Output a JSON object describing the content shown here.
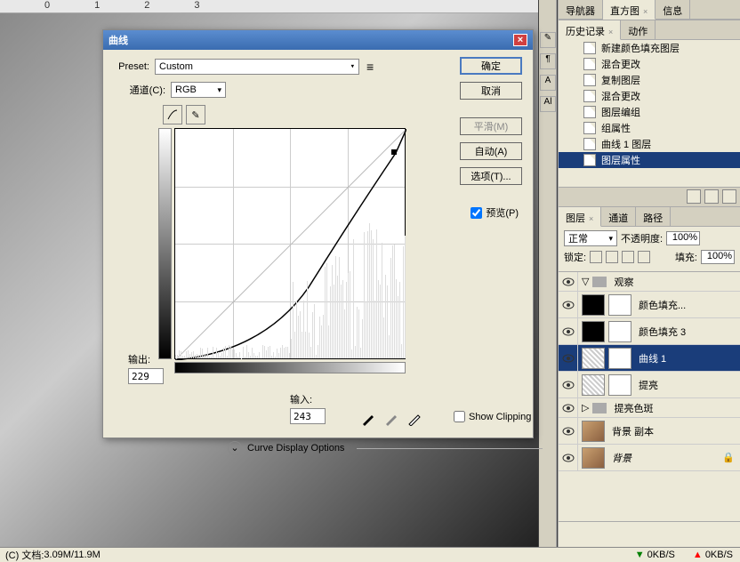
{
  "dialog": {
    "title": "曲线",
    "preset_label": "Preset:",
    "preset_value": "Custom",
    "channel_label": "通道(C):",
    "channel_value": "RGB",
    "output_label": "输出:",
    "output_value": "229",
    "input_label": "输入:",
    "input_value": "243",
    "show_clipping": "Show Clipping",
    "curve_options": "Curve Display Options",
    "buttons": {
      "ok": "确定",
      "cancel": "取消",
      "smooth": "平滑(M)",
      "auto": "自动(A)",
      "options": "选项(T)..."
    },
    "preview": "预览(P)"
  },
  "chart_data": {
    "type": "line",
    "title": "曲线",
    "xlabel": "输入",
    "ylabel": "输出",
    "xlim": [
      0,
      255
    ],
    "ylim": [
      0,
      255
    ],
    "grid": true,
    "series": [
      {
        "name": "diagonal",
        "x": [
          0,
          255
        ],
        "y": [
          0,
          255
        ]
      },
      {
        "name": "curve",
        "x": [
          0,
          50,
          100,
          150,
          200,
          243,
          255
        ],
        "y": [
          0,
          8,
          30,
          80,
          160,
          229,
          255
        ]
      }
    ],
    "points": [
      {
        "x": 0,
        "y": 0
      },
      {
        "x": 243,
        "y": 229
      },
      {
        "x": 255,
        "y": 255
      }
    ],
    "histogram_peaks": "right-weighted"
  },
  "panels": {
    "nav_tabs": [
      "导航器",
      "直方图",
      "信息"
    ],
    "nav_active": 1,
    "history_tabs": [
      "历史记录",
      "动作"
    ],
    "history_active": 0,
    "history_items": [
      "新建颜色填充图层",
      "混合更改",
      "复制图层",
      "混合更改",
      "图层编组",
      "组属性",
      "曲线 1 图层",
      "图层属性"
    ],
    "history_selected": 7,
    "layer_tabs": [
      "图层",
      "通道",
      "路径"
    ],
    "layer_active": 0,
    "blend_mode": "正常",
    "opacity_label": "不透明度:",
    "opacity_value": "100%",
    "lock_label": "锁定:",
    "fill_label": "填充:",
    "fill_value": "100%",
    "layers": [
      {
        "type": "group",
        "name": "观察",
        "expanded": true
      },
      {
        "type": "fill",
        "name": "颜色填充...",
        "thumb": "black"
      },
      {
        "type": "fill",
        "name": "颜色填充 3",
        "thumb": "black"
      },
      {
        "type": "curves",
        "name": "曲线 1",
        "selected": true
      },
      {
        "type": "curves",
        "name": "提亮"
      },
      {
        "type": "group",
        "name": "提亮色斑",
        "expanded": false
      },
      {
        "type": "image",
        "name": "背景 副本"
      },
      {
        "type": "image",
        "name": "背景",
        "locked": true,
        "italic": true
      }
    ]
  },
  "status": {
    "doc_label": "(C) 文档:",
    "doc_size": "3.09M/11.9M",
    "net_down": "0KB/S",
    "net_up": "0KB/S"
  }
}
